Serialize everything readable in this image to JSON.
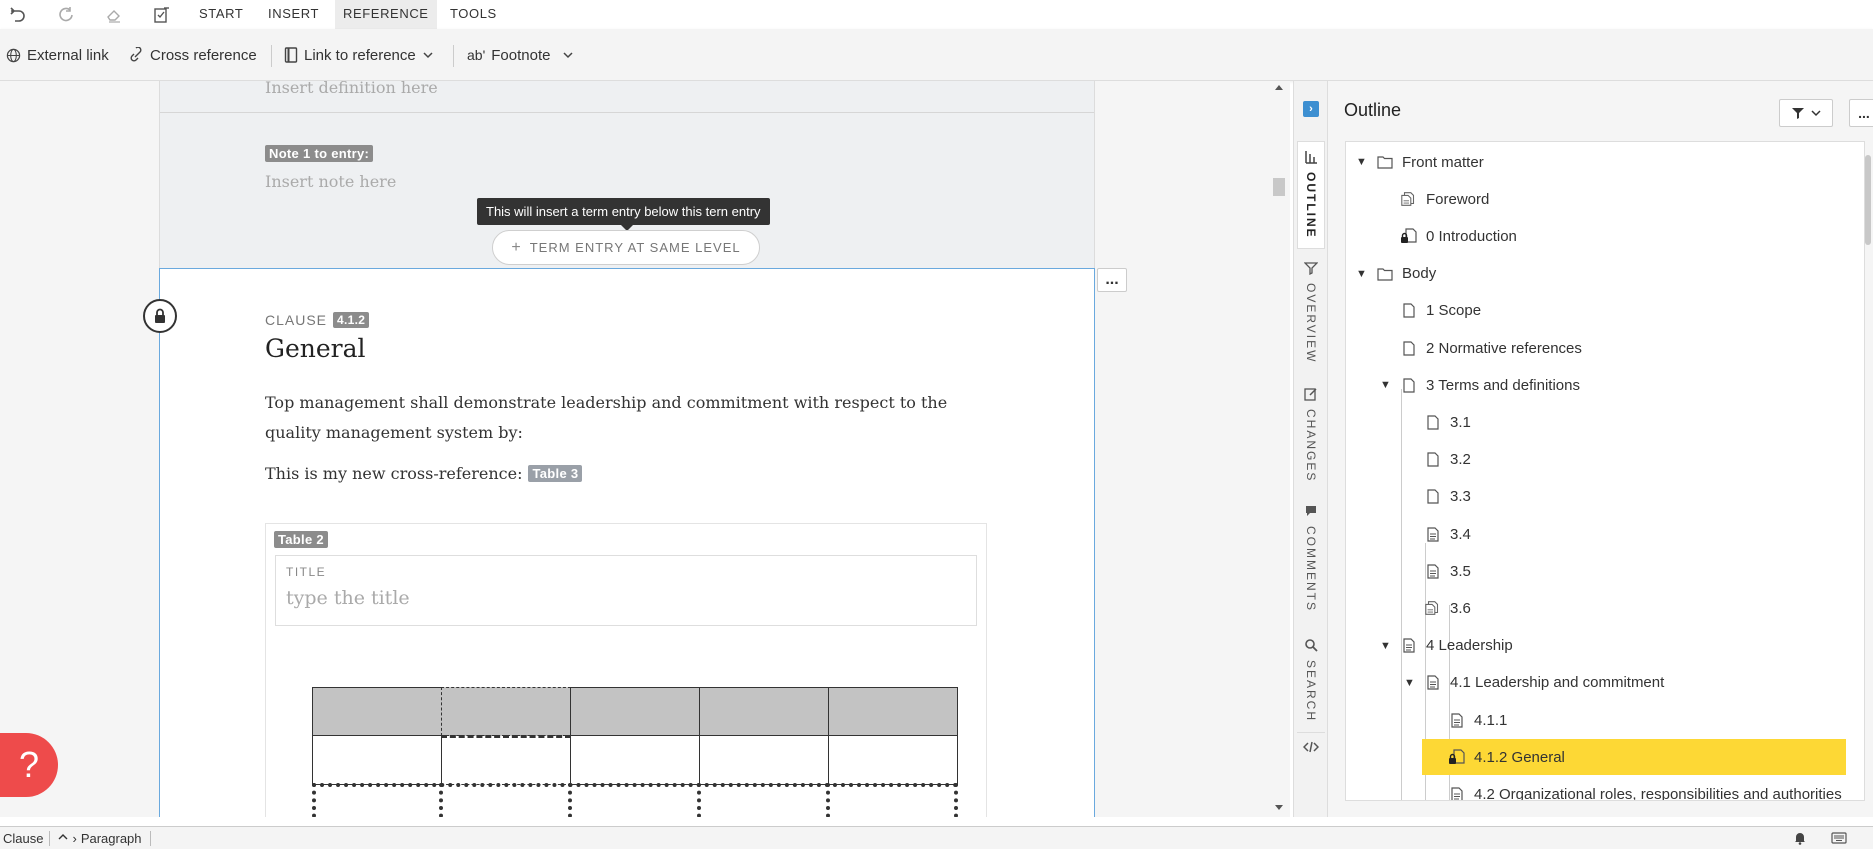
{
  "menubar": {
    "tabs": [
      "START",
      "INSERT",
      "REFERENCE",
      "TOOLS"
    ],
    "active_tab": "REFERENCE"
  },
  "toolbar": {
    "external_link": "External link",
    "cross_reference": "Cross reference",
    "link_to_reference": "Link to reference",
    "footnote": "Footnote",
    "footnote_prefix": "ab'"
  },
  "editor": {
    "prev_entry": {
      "definition_placeholder": "Insert definition here",
      "note_label": "Note 1 to entry:",
      "note_placeholder": "Insert note here"
    },
    "tooltip": "This will insert a term entry below this tern entry",
    "term_entry_button": "TERM ENTRY AT SAME LEVEL",
    "more_button": "...",
    "clause": {
      "kind": "CLAUSE",
      "number": "4.1.2",
      "heading": "General",
      "paragraph_1": "Top management shall demonstrate leadership and commitment with respect to the quality management system by:",
      "paragraph_2": "This is my new cross-reference:",
      "xref_badge": "Table 3",
      "table_badge": "Table 2",
      "table_title_label": "TITLE",
      "table_title_placeholder": "type the title"
    }
  },
  "sidetabs": [
    "OUTLINE",
    "OVERVIEW",
    "CHANGES",
    "COMMENTS",
    "SEARCH"
  ],
  "outline": {
    "title": "Outline",
    "more": "...",
    "items": [
      {
        "label": "Front matter",
        "icon": "folder-icon",
        "caret": true
      },
      {
        "label": "Foreword",
        "icon": "shared-doc-icon"
      },
      {
        "label": "0 Introduction",
        "icon": "locked-doc-icon"
      },
      {
        "label": "Body",
        "icon": "folder-icon",
        "caret": true
      },
      {
        "label": "1 Scope",
        "icon": "doc-icon"
      },
      {
        "label": "2 Normative references",
        "icon": "doc-icon"
      },
      {
        "label": "3 Terms and definitions",
        "icon": "doc-icon",
        "caret": true
      },
      {
        "label": "3.1",
        "icon": "doc-icon"
      },
      {
        "label": "3.2",
        "icon": "doc-icon"
      },
      {
        "label": "3.3",
        "icon": "doc-icon"
      },
      {
        "label": "3.4",
        "icon": "doc-lines-icon"
      },
      {
        "label": "3.5",
        "icon": "doc-lines-icon"
      },
      {
        "label": "3.6",
        "icon": "shared-doc-icon"
      },
      {
        "label": "4 Leadership",
        "icon": "doc-lines-icon",
        "caret": true
      },
      {
        "label": "4.1 Leadership and commitment",
        "icon": "doc-lines-icon",
        "caret": true
      },
      {
        "label": "4.1.1",
        "icon": "doc-lines-icon"
      },
      {
        "label": "4.1.2 General",
        "icon": "locked-doc-icon",
        "selected": true
      },
      {
        "label": "4.2 Organizational roles, responsibilities and authorities",
        "icon": "doc-lines-icon"
      }
    ]
  },
  "statusbar": {
    "crumb_1": "Clause",
    "crumb_2": "Paragraph"
  },
  "help": "?",
  "colors": {
    "selected": "#fdd835",
    "accent_border": "#6aa9de",
    "help": "#ee4b4b",
    "badge": "#8c8c8c"
  }
}
